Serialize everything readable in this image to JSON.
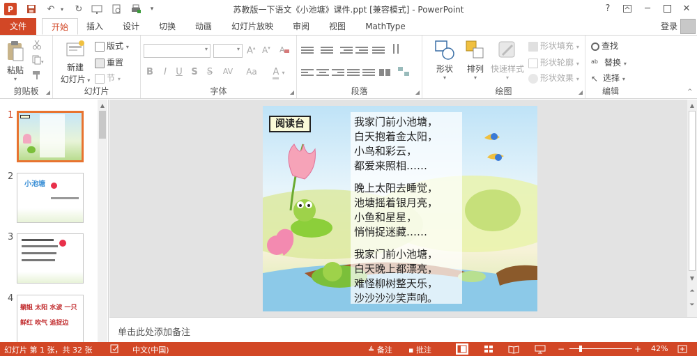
{
  "titlebar": {
    "title": "苏教版一下语文《小池塘》课件.ppt [兼容模式] - PowerPoint",
    "app_logo": "P",
    "help": "?",
    "minimize": "─",
    "close": "✕"
  },
  "tabs": {
    "file": "文件",
    "items": [
      "开始",
      "插入",
      "设计",
      "切换",
      "动画",
      "幻灯片放映",
      "审阅",
      "视图",
      "MathType"
    ],
    "active": "开始",
    "login": "登录"
  },
  "ribbon": {
    "clipboard": {
      "label": "剪贴板",
      "paste": "粘贴"
    },
    "slides": {
      "label": "幻灯片",
      "new_slide_1": "新建",
      "new_slide_2": "幻灯片",
      "layout": "版式",
      "reset": "重置",
      "section": "节"
    },
    "font": {
      "label": "字体",
      "bold": "B",
      "italic": "I",
      "underline": "U",
      "strike": "S",
      "spacing": "AV",
      "case": "Aa",
      "color": "A"
    },
    "paragraph": {
      "label": "段落"
    },
    "drawing": {
      "label": "绘图",
      "shapes": "形状",
      "arrange": "排列",
      "quick_styles": "快速样式",
      "shape_fill": "形状填充",
      "shape_outline": "形状轮廓",
      "shape_effects": "形状效果"
    },
    "editing": {
      "label": "编辑",
      "find": "查找",
      "replace": "替换",
      "select": "选择"
    }
  },
  "thumbnails": {
    "numbers": [
      "1",
      "2",
      "3",
      "4"
    ],
    "t2_title": "小池塘",
    "t4_row1": [
      "躺姐",
      "太阳",
      "水波",
      "一只"
    ],
    "t4_row2": [
      "鲜红",
      "吹气",
      "追捉边"
    ]
  },
  "slide": {
    "label": "阅读台",
    "poem": [
      "我家门前小池塘，",
      "白天抱着金太阳，",
      "小鸟和彩云，",
      "都爱来照相……",
      "晚上太阳去睡觉，",
      "池塘摇着银月亮，",
      "小鱼和星星，",
      "悄悄捉迷藏……",
      "我家门前小池塘，",
      "白天晚上都漂亮，",
      "难怪柳树整天乐，",
      "沙沙沙沙笑声响。"
    ]
  },
  "notes": {
    "placeholder": "单击此处添加备注"
  },
  "status": {
    "slide_info": "幻灯片 第 1 张，共 32 张",
    "language": "中文(中国)",
    "notes": "备注",
    "comments": "批注",
    "zoom": "42%",
    "zoom_level": 0.42
  },
  "colors": {
    "accent": "#d24726",
    "thumb_active": "#e8732f"
  },
  "icons": [
    "ppt-logo-icon",
    "save-icon",
    "undo-icon",
    "redo-icon",
    "paste-icon",
    "cut-icon",
    "copy-icon",
    "format-painter-icon",
    "new-slide-icon",
    "shapes-icon",
    "arrange-icon",
    "find-icon",
    "replace-icon",
    "select-icon"
  ]
}
